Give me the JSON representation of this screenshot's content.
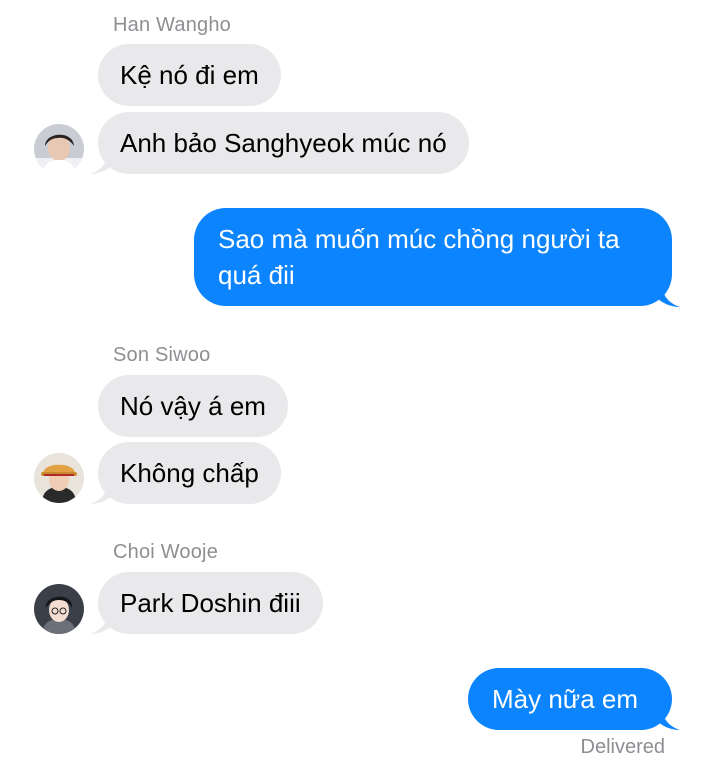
{
  "conversation": {
    "groups": [
      {
        "sender": "Han Wangho",
        "messages": [
          "Kệ nó đi em",
          "Anh bảo Sanghyeok múc nó"
        ]
      },
      {
        "sender": "Son Siwoo",
        "messages": [
          "Nó vậy á em",
          "Không chấp"
        ]
      },
      {
        "sender": "Choi Wooje",
        "messages": [
          "Park Doshin điii"
        ]
      }
    ],
    "outgoing": [
      {
        "line1": "Sao mà muốn múc chồng người ta",
        "line2": "quá đii"
      },
      {
        "text": "Mày nữa em"
      }
    ],
    "status": "Delivered"
  },
  "colors": {
    "sent_bubble": "#0b84fe",
    "received_bubble": "#e9e9eb",
    "meta_text": "#8e8e93"
  }
}
